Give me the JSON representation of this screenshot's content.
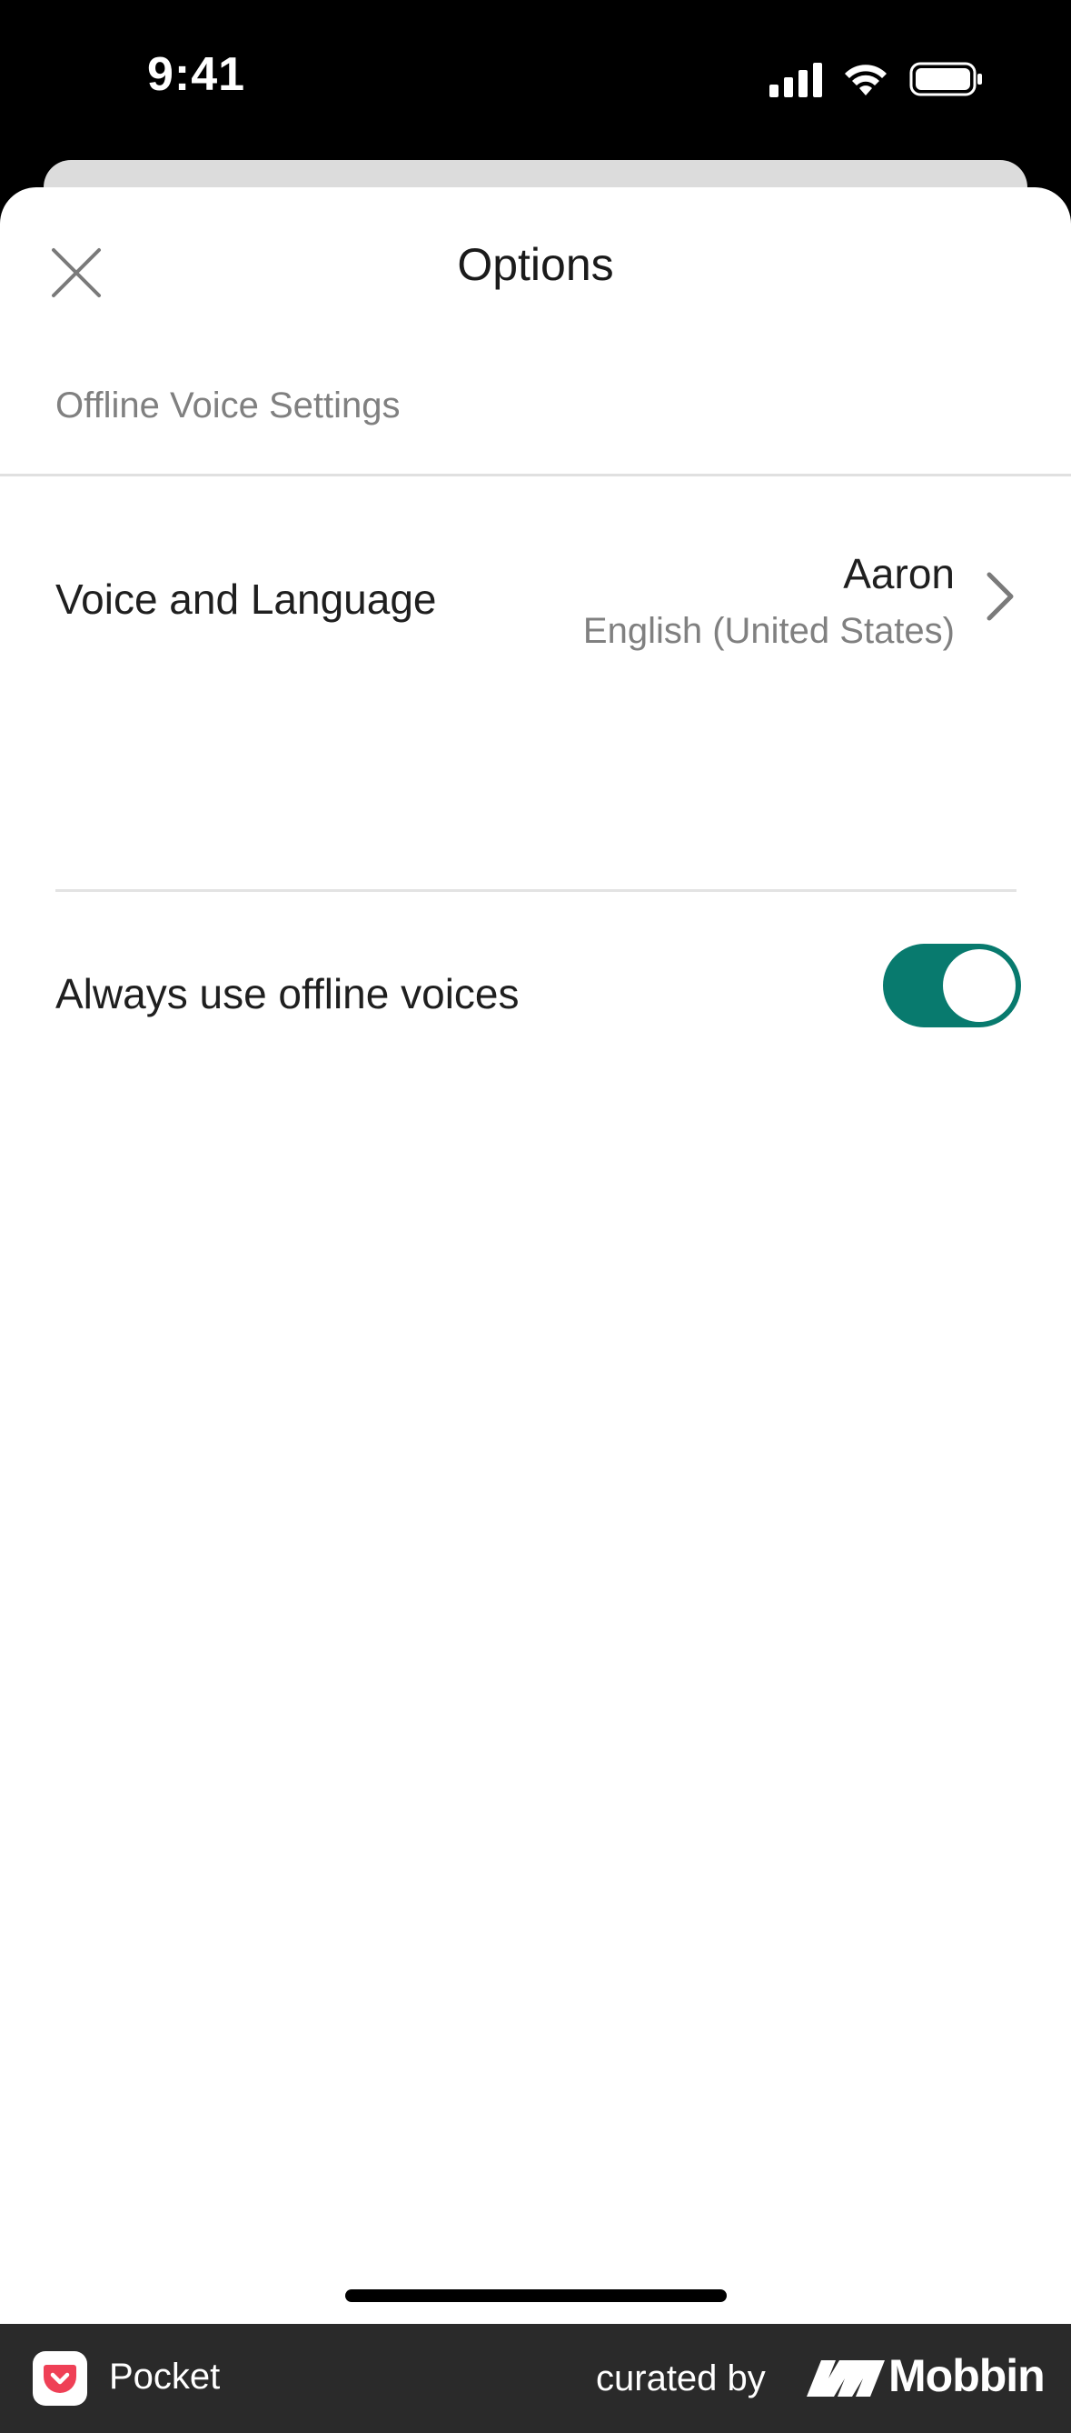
{
  "status_bar": {
    "time": "9:41"
  },
  "header": {
    "title": "Options",
    "close_icon": "close-icon"
  },
  "section": {
    "header": "Offline Voice Settings"
  },
  "voice_row": {
    "label": "Voice and Language",
    "voice_name": "Aaron",
    "language": "English (United States)"
  },
  "offline_row": {
    "label": "Always use offline voices",
    "toggle_on": true,
    "toggle_color": "#087a6e"
  },
  "footer": {
    "app_name": "Pocket",
    "curated_by": "curated by",
    "brand": "Mobbin"
  }
}
